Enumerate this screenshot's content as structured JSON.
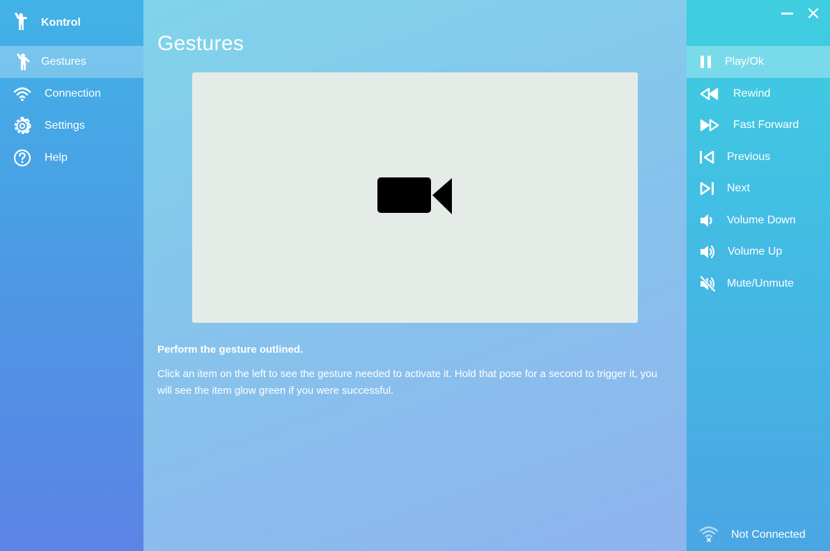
{
  "app": {
    "name": "Kontrol"
  },
  "sidebar": {
    "items": [
      {
        "label": "Gestures",
        "icon": "person-gesture-icon",
        "active": true
      },
      {
        "label": "Connection",
        "icon": "wifi-icon"
      },
      {
        "label": "Settings",
        "icon": "gear-icon"
      },
      {
        "label": "Help",
        "icon": "help-icon"
      }
    ]
  },
  "main": {
    "title": "Gestures",
    "preview_icon": "video-camera-icon",
    "instruction_title": "Perform the gesture outlined.",
    "instruction_text": "Click an item on the left to see the gesture needed to activate it. Hold that pose for a second to trigger it, you will see the item glow green if you were successful."
  },
  "actions": {
    "items": [
      {
        "label": "Play/Ok",
        "icon": "pause-icon",
        "active": true
      },
      {
        "label": "Rewind",
        "icon": "rewind-icon"
      },
      {
        "label": "Fast Forward",
        "icon": "fast-forward-icon"
      },
      {
        "label": "Previous",
        "icon": "skip-previous-icon"
      },
      {
        "label": "Next",
        "icon": "skip-next-icon"
      },
      {
        "label": "Volume Down",
        "icon": "volume-down-icon"
      },
      {
        "label": "Volume Up",
        "icon": "volume-up-icon"
      },
      {
        "label": "Mute/Unmute",
        "icon": "mute-icon"
      }
    ]
  },
  "status": {
    "label": "Not Connected",
    "icon": "wifi-off-icon"
  },
  "colors": {
    "sidebar_top": "#41b3e6",
    "sidebar_bottom": "#5c83e6",
    "right_panel_top": "#3ecfe0",
    "preview_bg": "#e5ece8"
  }
}
